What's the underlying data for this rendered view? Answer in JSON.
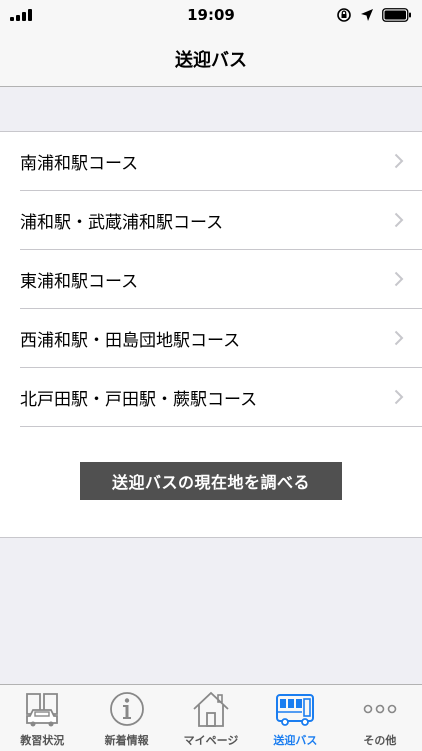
{
  "status_bar": {
    "time": "19:09"
  },
  "nav": {
    "title": "送迎バス"
  },
  "courses": [
    {
      "label": "南浦和駅コース"
    },
    {
      "label": "浦和駅・武蔵浦和駅コース"
    },
    {
      "label": "東浦和駅コース"
    },
    {
      "label": "西浦和駅・田島団地駅コース"
    },
    {
      "label": "北戸田駅・戸田駅・蕨駅コース"
    }
  ],
  "locate_button": {
    "label": "送迎バスの現在地を調べる"
  },
  "tabs": [
    {
      "label": "教習状況",
      "icon": "book-car-icon"
    },
    {
      "label": "新着情報",
      "icon": "info-icon"
    },
    {
      "label": "マイページ",
      "icon": "house-icon"
    },
    {
      "label": "送迎バス",
      "icon": "bus-icon",
      "active": true
    },
    {
      "label": "その他",
      "icon": "more-icon"
    }
  ],
  "colors": {
    "active_tab": "#1a7df0",
    "button_bg": "#505050",
    "background": "#efeff4"
  }
}
